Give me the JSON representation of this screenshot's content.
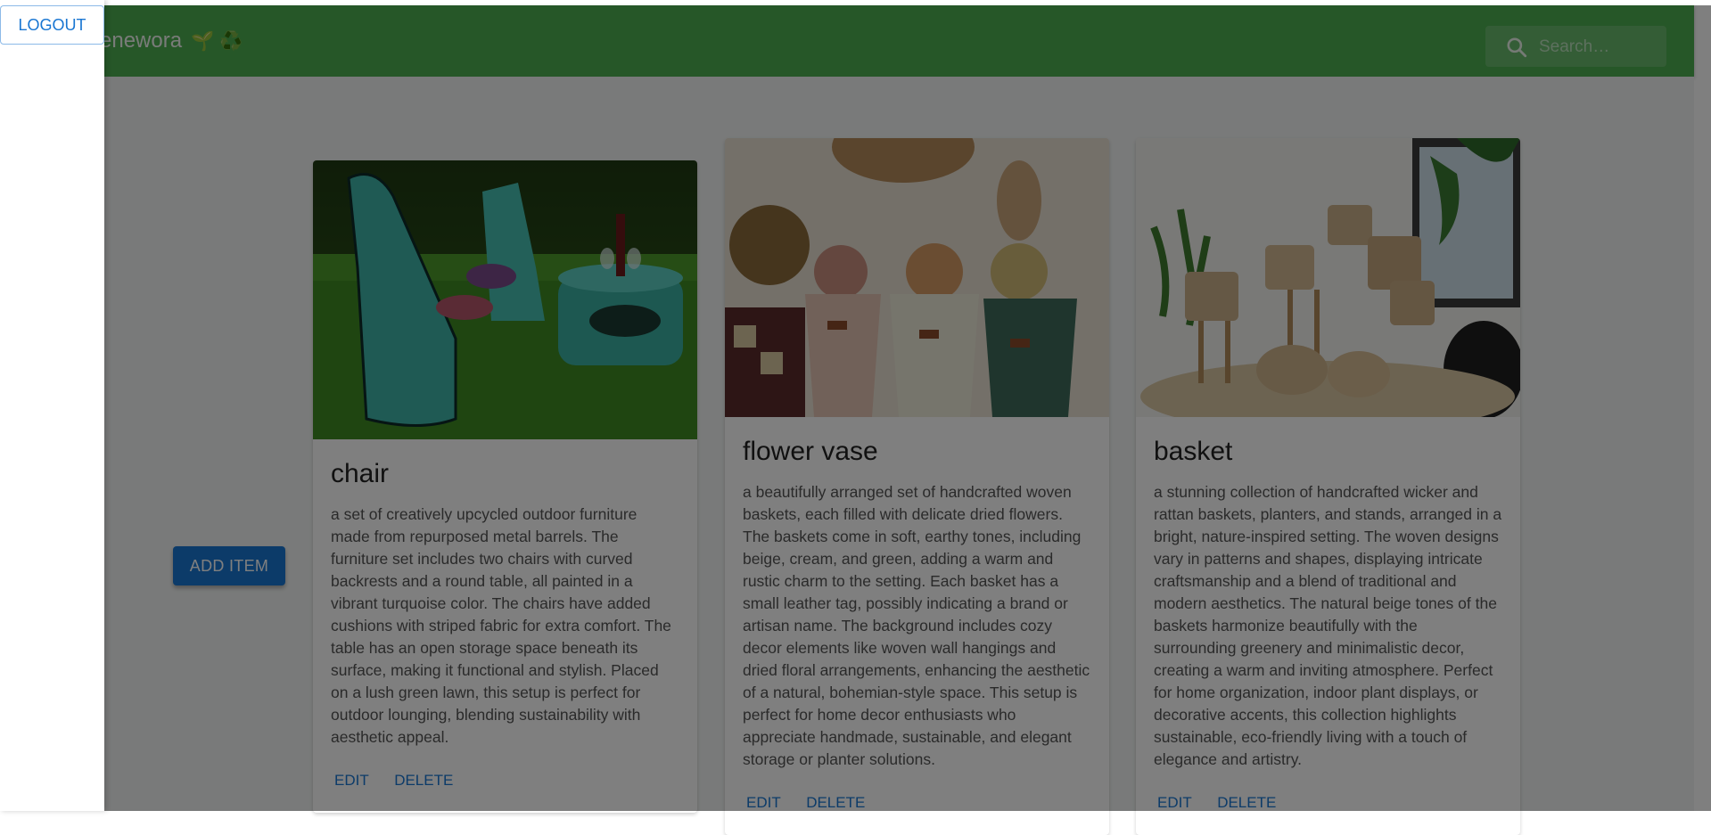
{
  "appbar": {
    "title": "enewora",
    "title_emoji": "🌱 ♻️",
    "search_placeholder": "Search…"
  },
  "drawer": {
    "logout_label": "LOGOUT"
  },
  "main": {
    "add_item_label": "ADD ITEM"
  },
  "cards": [
    {
      "title": "chair",
      "description": "a set of creatively upcycled outdoor furniture made from repurposed metal barrels. The furniture set includes two chairs with curved backrests and a round table, all painted in a vibrant turquoise color. The chairs have added cushions with striped fabric for extra comfort. The table has an open storage space beneath its surface, making it functional and stylish. Placed on a lush green lawn, this setup is perfect for outdoor lounging, blending sustainability with aesthetic appeal.",
      "edit_label": "EDIT",
      "delete_label": "DELETE"
    },
    {
      "title": "flower vase",
      "description": "a beautifully arranged set of handcrafted woven baskets, each filled with delicate dried flowers. The baskets come in soft, earthy tones, including beige, cream, and green, adding a warm and rustic charm to the setting. Each basket has a small leather tag, possibly indicating a brand or artisan name. The background includes cozy decor elements like woven wall hangings and dried floral arrangements, enhancing the aesthetic of a natural, bohemian-style space. This setup is perfect for home decor enthusiasts who appreciate handmade, sustainable, and elegant storage or planter solutions.",
      "edit_label": "EDIT",
      "delete_label": "DELETE"
    },
    {
      "title": "basket",
      "description": "a stunning collection of handcrafted wicker and rattan baskets, planters, and stands, arranged in a bright, nature-inspired setting. The woven designs vary in patterns and shapes, displaying intricate craftsmanship and a blend of traditional and modern aesthetics. The natural beige tones of the baskets harmonize beautifully with the surrounding greenery and minimalistic decor, creating a warm and inviting atmosphere. Perfect for home organization, indoor plant displays, or decorative accents, this collection highlights sustainable, eco-friendly living with a touch of elegance and artistry.",
      "edit_label": "EDIT",
      "delete_label": "DELETE"
    }
  ],
  "colors": {
    "appbar": "#4caf50",
    "primary": "#1976d2",
    "backdrop": "rgba(0,0,0,0.5)"
  }
}
